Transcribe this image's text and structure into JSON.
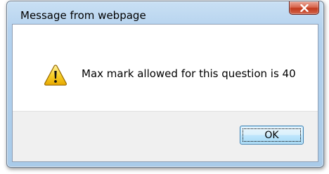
{
  "dialog": {
    "title": "Message from webpage",
    "message": "Max mark allowed for this question is 40",
    "ok_label": "OK",
    "icon": "warning-icon",
    "close_icon": "close-icon"
  },
  "colors": {
    "close_button": "#c23b1d",
    "warning_fill": "#f5c400",
    "ok_border": "#3c7fb1",
    "footer_bg": "#f0f0f0"
  }
}
